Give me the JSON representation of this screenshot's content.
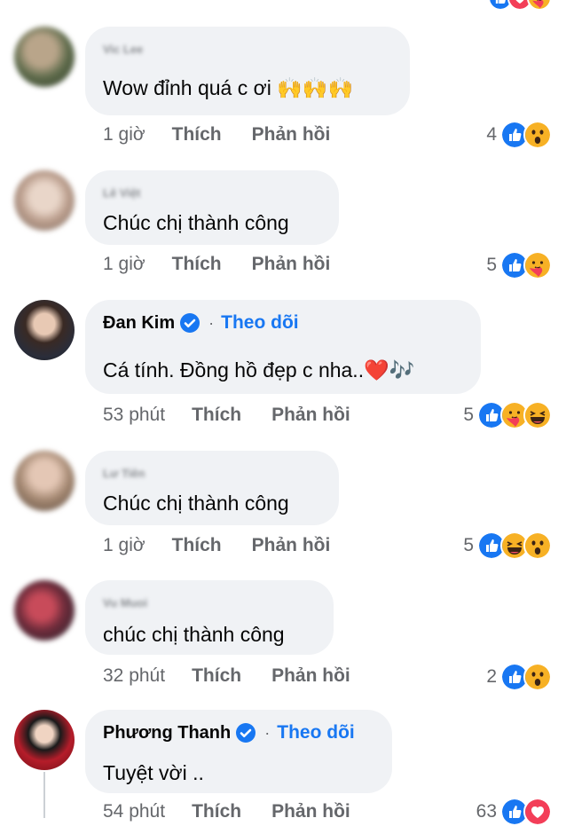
{
  "colors": {
    "bubble": "#f0f2f5",
    "link": "#1877f2",
    "meta": "#65676b"
  },
  "comments": [
    {
      "name": "Vic Lee",
      "text": "Wow đỉnh quá c ơi 🙌🙌🙌",
      "time": "1 giờ",
      "like": "Thích",
      "reply": "Phản hồi",
      "react_count": "4",
      "reactions": [
        "like-icon",
        "wow-icon"
      ]
    },
    {
      "name": "Lê Việt",
      "text": "Chúc chị thành công",
      "time": "1 giờ",
      "like": "Thích",
      "reply": "Phản hồi",
      "react_count": "5",
      "reactions": [
        "like-icon",
        "care-icon"
      ]
    },
    {
      "name": "Đan Kim",
      "follow": "Theo dõi",
      "separator": "·",
      "text": "Cá tính. Đồng hồ đẹp c nha..❤️🎶",
      "time": "53 phút",
      "like": "Thích",
      "reply": "Phản hồi",
      "react_count": "5",
      "reactions": [
        "like-icon",
        "care-icon",
        "haha-icon"
      ]
    },
    {
      "name": "Lư Tiên",
      "text": "Chúc chị thành công",
      "time": "1 giờ",
      "like": "Thích",
      "reply": "Phản hồi",
      "react_count": "5",
      "reactions": [
        "like-icon",
        "haha-icon",
        "wow-icon"
      ]
    },
    {
      "name": "Vu Muoi",
      "text": "chúc chị thành công",
      "time": "32 phút",
      "like": "Thích",
      "reply": "Phản hồi",
      "react_count": "2",
      "reactions": [
        "like-icon",
        "wow-icon"
      ]
    },
    {
      "name": "Phương Thanh",
      "follow": "Theo dõi",
      "separator": "·",
      "text": "Tuyệt vời ..",
      "time": "54 phút",
      "like": "Thích",
      "reply": "Phản hồi",
      "react_count": "63",
      "reactions": [
        "like-icon",
        "love-icon"
      ]
    }
  ]
}
